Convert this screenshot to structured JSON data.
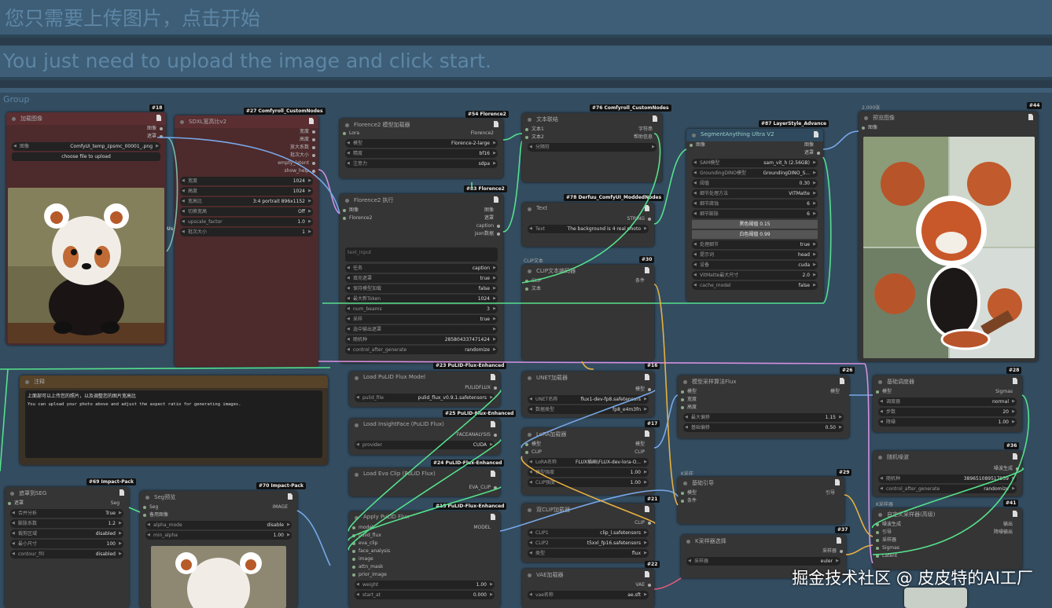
{
  "banners": {
    "zh": "您只需要上传图片，点击开始",
    "en": "You just need to upload the image and click start."
  },
  "group": {
    "title": "Group"
  },
  "watermark": "掘金技术社区 @ 皮皮特的AI工厂",
  "n_load": {
    "tag": "#18",
    "title": "加载图像",
    "out1": "图像",
    "out2": "遮罩",
    "image_label": "图像",
    "image_value": "ComfyUI_temp_zpsmc_00001_.png",
    "upload": "choose file to upload",
    "side": "Use"
  },
  "n_sdxl": {
    "tag": "#27 Comfyroll_CustomNodes",
    "title": "SDXL宽高比v2",
    "outs": [
      "宽度",
      "高度",
      "放大系数",
      "批次大小"
    ],
    "empty_latent": "empty_latent",
    "show_help": "show_help",
    "widgets": [
      [
        "宽度",
        "1024"
      ],
      [
        "高度",
        "1024"
      ],
      [
        "宽高比",
        "3:4 portrait 896x1152"
      ],
      [
        "切换宽高",
        "Off"
      ],
      [
        "upscale_factor",
        "1.0"
      ],
      [
        "批次大小",
        "1"
      ]
    ]
  },
  "n_fl_loader": {
    "tag": "#54 Florence2",
    "title": "Florence2 模型加载器",
    "in": "Lora",
    "out": "Florence2",
    "widgets": [
      [
        "模型",
        "Florence-2-large"
      ],
      [
        "精度",
        "bf16"
      ],
      [
        "注意力",
        "sdpa"
      ]
    ]
  },
  "n_fl_run": {
    "tag": "#83 Florence2",
    "title": "Florence2 执行",
    "ins": [
      "图像",
      "Florence2"
    ],
    "outs": [
      "图像",
      "遮罩",
      "caption",
      "json数据"
    ],
    "ta": "text_input",
    "widgets": [
      [
        "任务",
        "caption"
      ],
      [
        "填充遮罩",
        "true"
      ],
      [
        "保持模型加载",
        "false"
      ],
      [
        "最大新Token",
        "1024"
      ],
      [
        "num_beams",
        "3"
      ],
      [
        "采样",
        "true"
      ],
      [
        "选中输出遮罩",
        ""
      ],
      [
        "随机种",
        "285804337471424"
      ],
      [
        "control_after_generate",
        "randomize"
      ]
    ]
  },
  "n_text_concat": {
    "tag": "#76 Comfyroll_CustomNodes",
    "title": "文本联结",
    "ins": [
      "文本1",
      "文本2"
    ],
    "outs": [
      "字符串",
      "帮助信息"
    ],
    "sep": "分隔符"
  },
  "n_text": {
    "tag": "#78 Derfuu_ComfyUI_ModdedNodes",
    "title": "Text",
    "out": "STRING",
    "label": "Text",
    "value": "The background is 4 real photo"
  },
  "n_clip_enc": {
    "tag": "#30",
    "title": "CLIP文本编码器",
    "pre": "CLIP文本",
    "ins": [
      "CLIP",
      "文本"
    ],
    "out": "条件"
  },
  "n_seg": {
    "tag": "#87 LayerStyle_Advance",
    "title": "SegmentAnything Ultra V2",
    "in": "图像",
    "outs": [
      "图像",
      "遮罩"
    ],
    "widgets": [
      [
        "SAM模型",
        "sam_vit_h (2.56GB)"
      ],
      [
        "GroundingDINO模型",
        "GroundingDINO_S..."
      ],
      [
        "阈值",
        "0.30"
      ],
      [
        "细节处理方法",
        "VITMatte"
      ],
      [
        "细节腐蚀",
        "6"
      ],
      [
        "细节膨胀",
        "6"
      ]
    ],
    "gray1": "黑色阈值 0.15",
    "gray2": "白色阈值 0.99",
    "widgets2": [
      [
        "处理细节",
        "true"
      ],
      [
        "提示词",
        "head"
      ],
      [
        "设备",
        "cuda"
      ],
      [
        "VitMatte最大尺寸",
        "2.0"
      ],
      [
        "cache_model",
        "false"
      ]
    ]
  },
  "n_preview1": {
    "tag": "#44",
    "title": "预览图像",
    "pre": "2,000张",
    "in": "图像"
  },
  "n_note": {
    "title": "注释",
    "line1": "上面部可以上传您的照片，以及调整您的图片宽高比",
    "line2": "You can upload your photo above and adjust the aspect ratio for generating images."
  },
  "n_pulid_model": {
    "tag": "#23 PuLID-Flux-Enhanced",
    "title": "Load PuLID Flux Model",
    "out": "PULIDFLUX",
    "label": "pulid_file",
    "value": "pulid_flux_v0.9.1.safetensors"
  },
  "n_insight": {
    "tag": "#25 PuLID-Flux-Enhanced",
    "title": "Load InsightFace (PuLID Flux)",
    "out": "FACEANALYSIS",
    "label": "provider",
    "value": "CUDA"
  },
  "n_eva": {
    "tag": "#24 PuLID-Flux-Enhanced",
    "title": "Load Eva Clip (PuLID Flux)",
    "out": "EVA_CLIP"
  },
  "n_apply": {
    "tag": "#15 PuLID-Flux-Enhanced",
    "title": "Apply PuLID Flux",
    "ins": [
      "model",
      "pulid_flux",
      "eva_clip",
      "face_analysis",
      "image",
      "attn_mask",
      "prior_image"
    ],
    "out": "MODEL",
    "widgets": [
      [
        "weight",
        "1.00"
      ],
      [
        "start_at",
        "0.000"
      ]
    ]
  },
  "n_unet": {
    "tag": "#16",
    "title": "UNET加载器",
    "out": "模型",
    "widgets": [
      [
        "UNET名称",
        "flux1-dev-fp8.safetensors"
      ],
      [
        "数据类型",
        "fp8_e4m3fn"
      ]
    ]
  },
  "n_lora": {
    "tag": "#17",
    "title": "LoRA加载器",
    "ins": [
      "模型",
      "CLIP"
    ],
    "outs": [
      "模型",
      "CLIP"
    ],
    "widgets": [
      [
        "LoRA名称",
        "FLUX插画\\FLUX-dev-lora-O..."
      ],
      [
        "模型强度",
        "1.00"
      ],
      [
        "CLIP强度",
        "1.00"
      ]
    ]
  },
  "n_dualclip": {
    "tag": "#21",
    "title": "双CLIP加载器",
    "out": "CLIP",
    "widgets": [
      [
        "CLIP1",
        "clip_l.safetensors"
      ],
      [
        "CLIP2",
        "t5xxl_fp16.safetensors"
      ],
      [
        "类型",
        "flux"
      ]
    ]
  },
  "n_vae": {
    "tag": "#22",
    "title": "VAE加载器",
    "out": "VAE",
    "widgets": [
      [
        "vae名称",
        "ae.sft"
      ]
    ]
  },
  "n_model_samp": {
    "tag": "#26",
    "title": "模型采样算法Flux",
    "ins": [
      "模型",
      "宽度",
      "高度"
    ],
    "out": "模型",
    "widgets": [
      [
        "最大偏移",
        "1.15"
      ],
      [
        "基础偏移",
        "0.50"
      ]
    ]
  },
  "n_guider": {
    "tag": "#29",
    "title": "基础引导",
    "pre": "K采样",
    "ins": [
      "模型",
      "条件"
    ],
    "out": "引导"
  },
  "n_ksel": {
    "tag": "#37",
    "title": "K采样器选择",
    "out": "采样器",
    "widgets": [
      [
        "采样器",
        "euler"
      ]
    ]
  },
  "n_sched": {
    "tag": "#28",
    "title": "基础调度器",
    "in": "模型",
    "out": "Sigmas",
    "widgets": [
      [
        "调度器",
        "normal"
      ],
      [
        "步数",
        "20"
      ],
      [
        "降噪",
        "1.00"
      ]
    ]
  },
  "n_noise": {
    "tag": "#36",
    "title": "随机噪波",
    "out": "噪波生成",
    "widgets": [
      [
        "随机种",
        "389651089517959"
      ],
      [
        "control_after_generate",
        "randomize"
      ]
    ]
  },
  "n_custom": {
    "tag": "#41",
    "title": "自定义采样器(高级)",
    "pre": "K采样器",
    "ins": [
      "噪波生成",
      "引导",
      "采样器",
      "Sigmas",
      "Latent"
    ],
    "outs": [
      "输出",
      "降噪输出"
    ]
  },
  "n_seg2": {
    "tag": "#69 Impact-Pack",
    "title": "遮罩到SEG",
    "in": "遮罩",
    "out": "Seg",
    "widgets": [
      [
        "合并分析",
        "True"
      ],
      [
        "膨胀系数",
        "1.2"
      ],
      [
        "裁剪区域",
        "disabled"
      ],
      [
        "最小尺寸",
        "100"
      ],
      [
        "contour_fill",
        "disabled"
      ]
    ]
  },
  "n_segprev": {
    "tag": "#70 Impact-Pack",
    "title": "Seg预览",
    "ins": [
      "Seg",
      "备用图像"
    ],
    "out": "IMAGE",
    "widgets": [
      [
        "alpha_mode",
        "disable"
      ],
      [
        "min_alpha",
        "1.00"
      ]
    ]
  }
}
